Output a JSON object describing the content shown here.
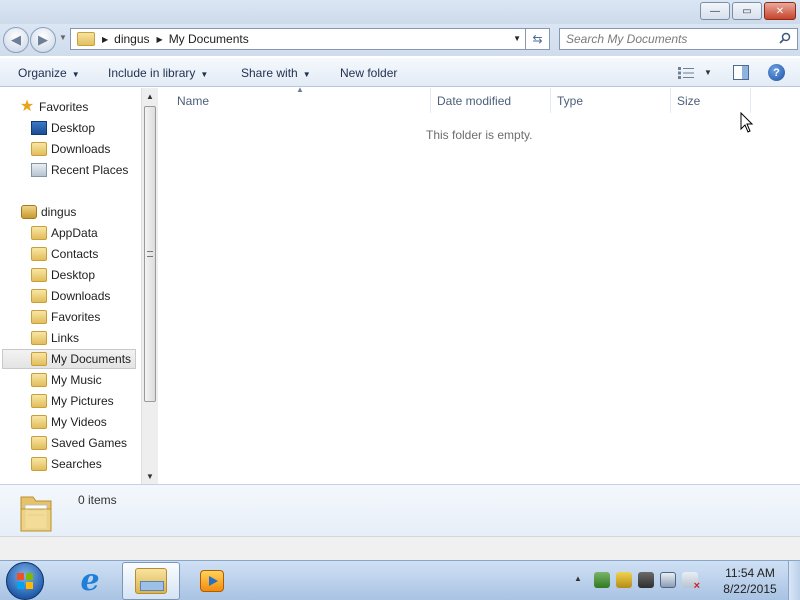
{
  "window": {
    "minimize_glyph": "—",
    "restore_glyph": "▭",
    "close_glyph": "✕"
  },
  "address": {
    "breadcrumbs": [
      "dingus",
      "My Documents"
    ],
    "search_placeholder": "Search My Documents"
  },
  "toolbar": {
    "organize": "Organize",
    "include_in_library": "Include in library",
    "share_with": "Share with",
    "new_folder": "New folder"
  },
  "nav": {
    "favorites": {
      "label": "Favorites",
      "items": [
        "Desktop",
        "Downloads",
        "Recent Places"
      ]
    },
    "user": {
      "label": "dingus",
      "items": [
        "AppData",
        "Contacts",
        "Desktop",
        "Downloads",
        "Favorites",
        "Links",
        "My Documents",
        "My Music",
        "My Pictures",
        "My Videos",
        "Saved Games",
        "Searches"
      ],
      "selected": "My Documents"
    }
  },
  "content": {
    "columns": [
      "Name",
      "Date modified",
      "Type",
      "Size"
    ],
    "empty_message": "This folder is empty."
  },
  "details": {
    "item_count": "0 items"
  },
  "taskbar": {
    "time": "11:54 AM",
    "date": "8/22/2015",
    "pinned": [
      "internet-explorer",
      "windows-explorer",
      "media-player"
    ],
    "active": "windows-explorer"
  },
  "colors": {
    "accent": "#1e3050",
    "folder": "#e2bd5a",
    "taskbar": "#a9c3e3"
  }
}
